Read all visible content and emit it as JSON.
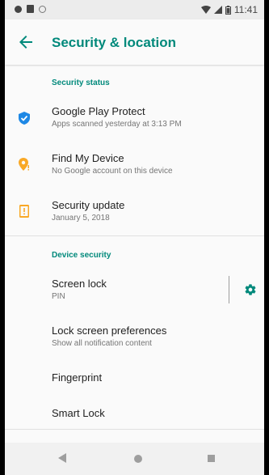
{
  "status_bar": {
    "time": "11:41"
  },
  "app_bar": {
    "title": "Security & location",
    "back_icon": "arrow-left-icon"
  },
  "sections": {
    "security_status": {
      "header": "Security status",
      "items": [
        {
          "title": "Google Play Protect",
          "subtitle": "Apps scanned yesterday at 3:13 PM",
          "icon": "shield-check-icon",
          "color": "#1e88e5"
        },
        {
          "title": "Find My Device",
          "subtitle": "No Google account on this device",
          "icon": "location-alert-icon",
          "color": "#f9a825"
        },
        {
          "title": "Security update",
          "subtitle": "January 5, 2018",
          "icon": "security-update-icon",
          "color": "#f9a825"
        }
      ]
    },
    "device_security": {
      "header": "Device security",
      "items": [
        {
          "title": "Screen lock",
          "subtitle": "PIN",
          "settings_icon": "gear-icon"
        },
        {
          "title": "Lock screen preferences",
          "subtitle": "Show all notification content"
        },
        {
          "title": "Fingerprint"
        },
        {
          "title": "Smart Lock"
        }
      ]
    }
  },
  "colors": {
    "accent": "#00897b",
    "text_primary": "#212121",
    "text_secondary": "#757575"
  }
}
